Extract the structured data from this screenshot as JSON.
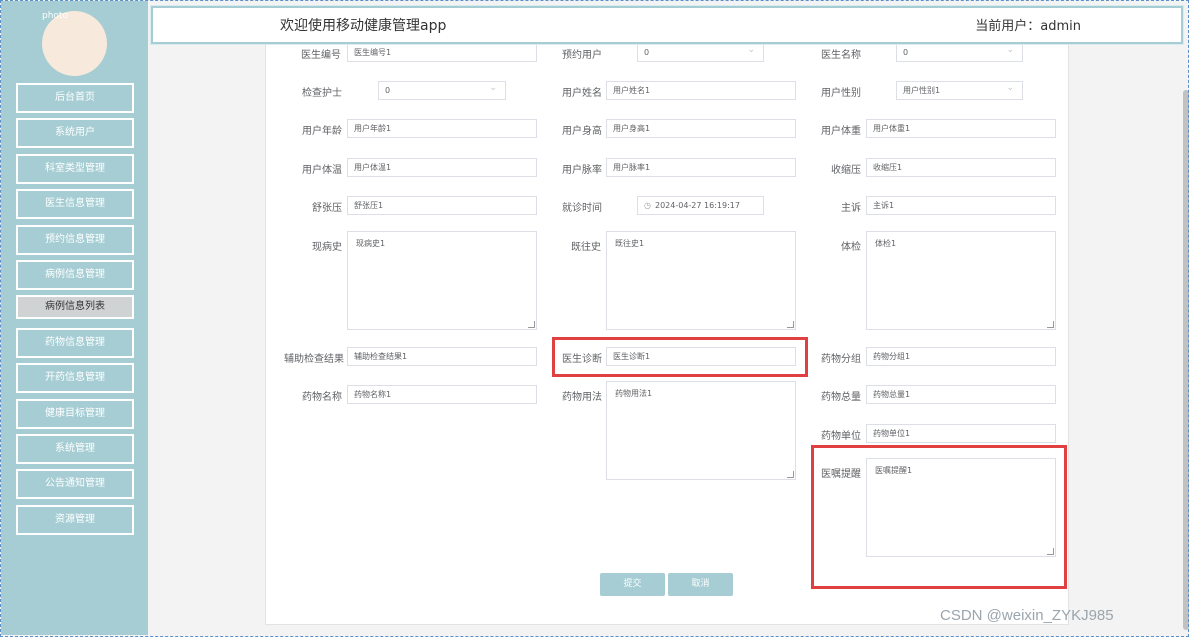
{
  "header": {
    "title": "欢迎使用移动健康管理app",
    "user": "当前用户：admin"
  },
  "avatar_alt": "photo",
  "sidebar": {
    "items": [
      {
        "label": "后台首页"
      },
      {
        "label": "系统用户"
      },
      {
        "label": "科室类型管理"
      },
      {
        "label": "医生信息管理"
      },
      {
        "label": "预约信息管理"
      },
      {
        "label": "病例信息管理"
      },
      {
        "label": "病例信息列表"
      },
      {
        "label": "药物信息管理"
      },
      {
        "label": "开药信息管理"
      },
      {
        "label": "健康目标管理"
      },
      {
        "label": "系统管理"
      },
      {
        "label": "公告通知管理"
      },
      {
        "label": "资源管理"
      }
    ]
  },
  "form": {
    "doctor_no": {
      "label": "医生编号",
      "value": "医生编号1"
    },
    "booking_user": {
      "label": "预约用户",
      "value": "0"
    },
    "doctor_name": {
      "label": "医生名称",
      "value": "0"
    },
    "nurse": {
      "label": "检查护士",
      "value": "0"
    },
    "user_name": {
      "label": "用户姓名",
      "value": "用户姓名1"
    },
    "user_gender": {
      "label": "用户性别",
      "value": "用户性别1"
    },
    "user_age": {
      "label": "用户年龄",
      "value": "用户年龄1"
    },
    "user_height": {
      "label": "用户身高",
      "value": "用户身高1"
    },
    "user_weight": {
      "label": "用户体重",
      "value": "用户体重1"
    },
    "user_temp": {
      "label": "用户体温",
      "value": "用户体温1"
    },
    "user_pulse": {
      "label": "用户脉率",
      "value": "用户脉率1"
    },
    "systolic": {
      "label": "收缩压",
      "value": "收缩压1"
    },
    "diastolic": {
      "label": "舒张压",
      "value": "舒张压1"
    },
    "visit_time": {
      "label": "就诊时间",
      "value": "2024-04-27 16:19:17"
    },
    "complaint": {
      "label": "主诉",
      "value": "主诉1"
    },
    "present_history": {
      "label": "现病史",
      "value": "现病史1"
    },
    "past_history": {
      "label": "既往史",
      "value": "既往史1"
    },
    "physical_exam": {
      "label": "体检",
      "value": "体检1"
    },
    "aux_result": {
      "label": "辅助检查结果",
      "value": "辅助检查结果1"
    },
    "diagnosis": {
      "label": "医生诊断",
      "value": "医生诊断1"
    },
    "drug_group": {
      "label": "药物分组",
      "value": "药物分组1"
    },
    "drug_name": {
      "label": "药物名称",
      "value": "药物名称1"
    },
    "drug_usage": {
      "label": "药物用法",
      "value": "药物用法1"
    },
    "drug_total": {
      "label": "药物总量",
      "value": "药物总量1"
    },
    "drug_unit": {
      "label": "药物单位",
      "value": "药物单位1"
    },
    "advice": {
      "label": "医嘱提醒",
      "value": "医嘱提醒1"
    }
  },
  "buttons": {
    "submit": "提交",
    "cancel": "取消"
  },
  "watermark": "CSDN @weixin_ZYKJ985",
  "colors": {
    "sidebar_bg": "#a5cdd3",
    "highlight": "#e04040"
  }
}
